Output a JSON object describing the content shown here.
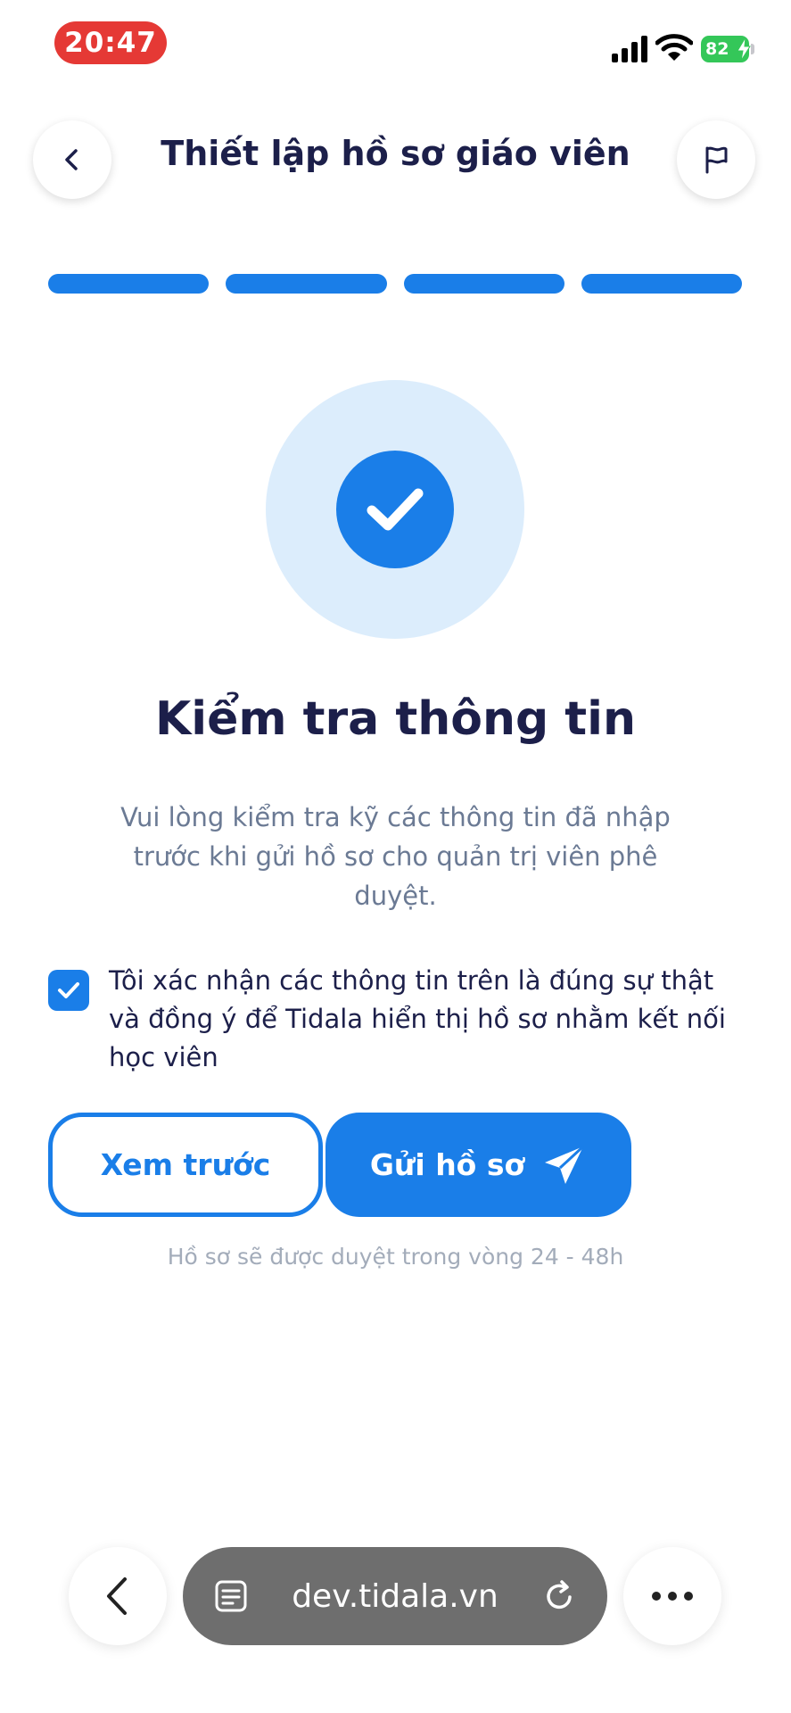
{
  "status_bar": {
    "time": "20:47",
    "battery": "82"
  },
  "header": {
    "title": "Thiết lập hồ sơ giáo viên"
  },
  "progress": {
    "steps_total": 4,
    "steps_completed": 4
  },
  "content": {
    "heading": "Kiểm tra thông tin",
    "description": "Vui lòng kiểm tra kỹ các thông tin đã nhập trước khi gửi hồ sơ cho quản trị viên phê duyệt.",
    "consent_text": "Tôi xác nhận các thông tin trên là đúng sự thật và đồng ý để Tidala hiển thị hồ sơ nhằm kết nối học viên",
    "consent_checked": true
  },
  "actions": {
    "preview_label": "Xem trước",
    "send_label": "Gửi hồ sơ",
    "note": "Hồ sơ sẽ được duyệt trong vòng 24 - 48h"
  },
  "browser": {
    "url": "dev.tidala.vn"
  },
  "icons": {
    "back": "chevron-left-icon",
    "flag": "flag-icon",
    "success": "check-circle-icon",
    "send": "paper-plane-icon",
    "reader": "reader-mode-icon",
    "reload": "reload-icon",
    "more": "more-dots-icon"
  },
  "colors": {
    "primary": "#1a7ee8",
    "halo": "#dcedfc",
    "heading": "#1c1f4a",
    "muted": "#6b7a94",
    "time_pill": "#e53935",
    "battery": "#34c759"
  }
}
